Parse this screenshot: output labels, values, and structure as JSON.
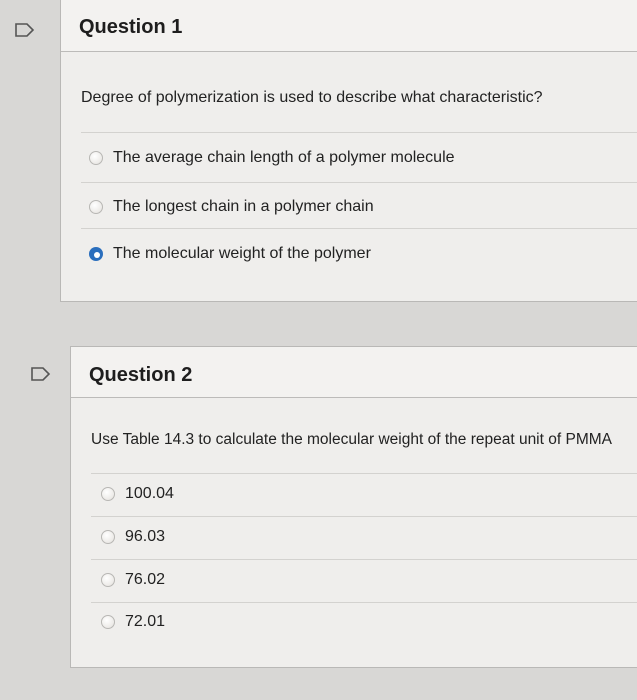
{
  "questions": [
    {
      "title": "Question 1",
      "prompt": "Degree of polymerization is used to describe what characteristic?",
      "options": [
        {
          "label": "The average chain length of a polymer molecule",
          "selected": false
        },
        {
          "label": "The longest chain in a polymer chain",
          "selected": false
        },
        {
          "label": "The molecular weight of the polymer",
          "selected": true
        }
      ]
    },
    {
      "title": "Question 2",
      "prompt": "Use Table 14.3 to calculate the molecular weight of the repeat unit of PMMA",
      "options": [
        {
          "label": "100.04",
          "selected": false
        },
        {
          "label": "96.03",
          "selected": false
        },
        {
          "label": "76.02",
          "selected": false
        },
        {
          "label": "72.01",
          "selected": false
        }
      ]
    }
  ],
  "colors": {
    "accent": "#2a6ebd",
    "card_bg": "#efeeec",
    "header_bg": "#f3f2f0"
  },
  "icons": {
    "flag": "flag-icon"
  }
}
